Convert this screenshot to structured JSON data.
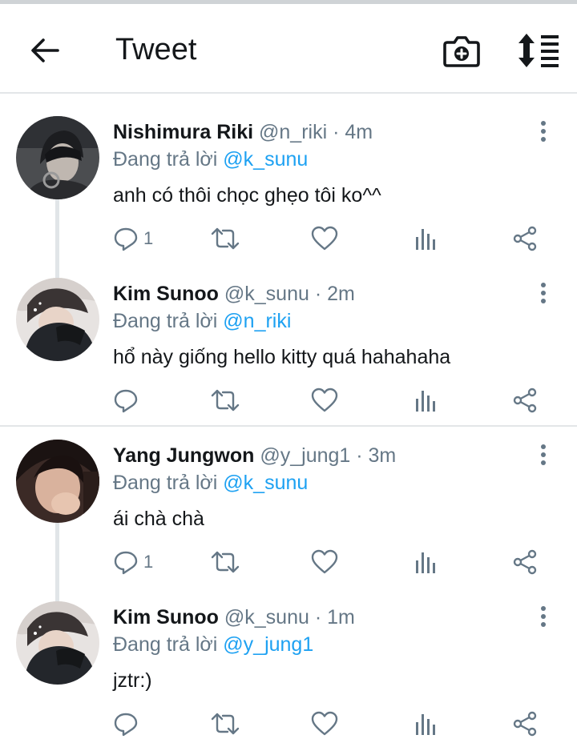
{
  "header": {
    "title": "Tweet"
  },
  "icons": {
    "back": "back-arrow-icon",
    "camera": "camera-add-icon",
    "sort": "sort-icon",
    "more": "more-vertical-icon",
    "reply": "reply-icon",
    "retweet": "retweet-icon",
    "like": "like-icon",
    "analytics": "analytics-icon",
    "share": "share-icon"
  },
  "colors": {
    "link": "#1da1f2",
    "muted": "#657786",
    "text": "#14171a"
  },
  "tweets": [
    {
      "name": "Nishimura Riki",
      "handle": "@n_riki · 4m",
      "reply_prefix": "Đang trả lời ",
      "reply_to": "@k_sunu",
      "text": "anh có thôi chọc ghẹo tôi ko^^",
      "reply_count": "1"
    },
    {
      "name": "Kim Sunoo",
      "handle": "@k_sunu · 2m",
      "reply_prefix": "Đang trả lời ",
      "reply_to": "@n_riki",
      "text": "hổ này giống hello kitty quá hahahaha",
      "reply_count": ""
    },
    {
      "name": "Yang Jungwon",
      "handle": "@y_jung1 · 3m",
      "reply_prefix": "Đang trả lời ",
      "reply_to": "@k_sunu",
      "text": "ái chà chà",
      "reply_count": "1"
    },
    {
      "name": "Kim Sunoo",
      "handle": "@k_sunu · 1m",
      "reply_prefix": "Đang trả lời ",
      "reply_to": "@y_jung1",
      "text": "jztr:)",
      "reply_count": ""
    }
  ]
}
